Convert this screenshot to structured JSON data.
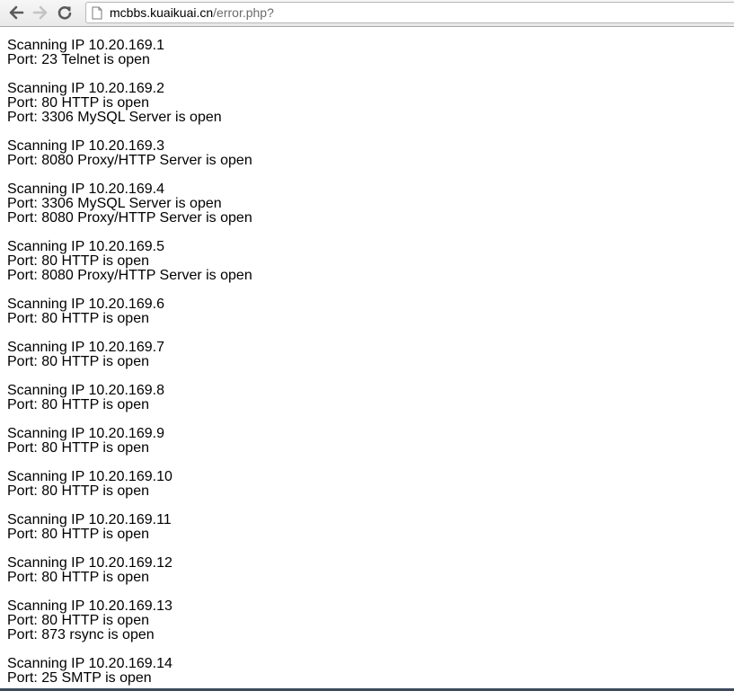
{
  "browser": {
    "url_host": "mcbbs.kuaikuai.cn",
    "url_path": "/error.php?"
  },
  "scan_results": [
    {
      "ip_line": "Scanning IP 10.20.169.1",
      "ports": [
        "Port: 23 Telnet is open"
      ]
    },
    {
      "ip_line": "Scanning IP 10.20.169.2",
      "ports": [
        "Port: 80 HTTP is open",
        "Port: 3306 MySQL Server is open"
      ]
    },
    {
      "ip_line": "Scanning IP 10.20.169.3",
      "ports": [
        "Port: 8080 Proxy/HTTP Server is open"
      ]
    },
    {
      "ip_line": "Scanning IP 10.20.169.4",
      "ports": [
        "Port: 3306 MySQL Server is open",
        "Port: 8080 Proxy/HTTP Server is open"
      ]
    },
    {
      "ip_line": "Scanning IP 10.20.169.5",
      "ports": [
        "Port: 80 HTTP is open",
        "Port: 8080 Proxy/HTTP Server is open"
      ]
    },
    {
      "ip_line": "Scanning IP 10.20.169.6",
      "ports": [
        "Port: 80 HTTP is open"
      ]
    },
    {
      "ip_line": "Scanning IP 10.20.169.7",
      "ports": [
        "Port: 80 HTTP is open"
      ]
    },
    {
      "ip_line": "Scanning IP 10.20.169.8",
      "ports": [
        "Port: 80 HTTP is open"
      ]
    },
    {
      "ip_line": "Scanning IP 10.20.169.9",
      "ports": [
        "Port: 80 HTTP is open"
      ]
    },
    {
      "ip_line": "Scanning IP 10.20.169.10",
      "ports": [
        "Port: 80 HTTP is open"
      ]
    },
    {
      "ip_line": "Scanning IP 10.20.169.11",
      "ports": [
        "Port: 80 HTTP is open"
      ]
    },
    {
      "ip_line": "Scanning IP 10.20.169.12",
      "ports": [
        "Port: 80 HTTP is open"
      ]
    },
    {
      "ip_line": "Scanning IP 10.20.169.13",
      "ports": [
        "Port: 80 HTTP is open",
        "Port: 873 rsync is open"
      ]
    },
    {
      "ip_line": "Scanning IP 10.20.169.14",
      "ports": [
        "Port: 25 SMTP is open"
      ]
    }
  ]
}
